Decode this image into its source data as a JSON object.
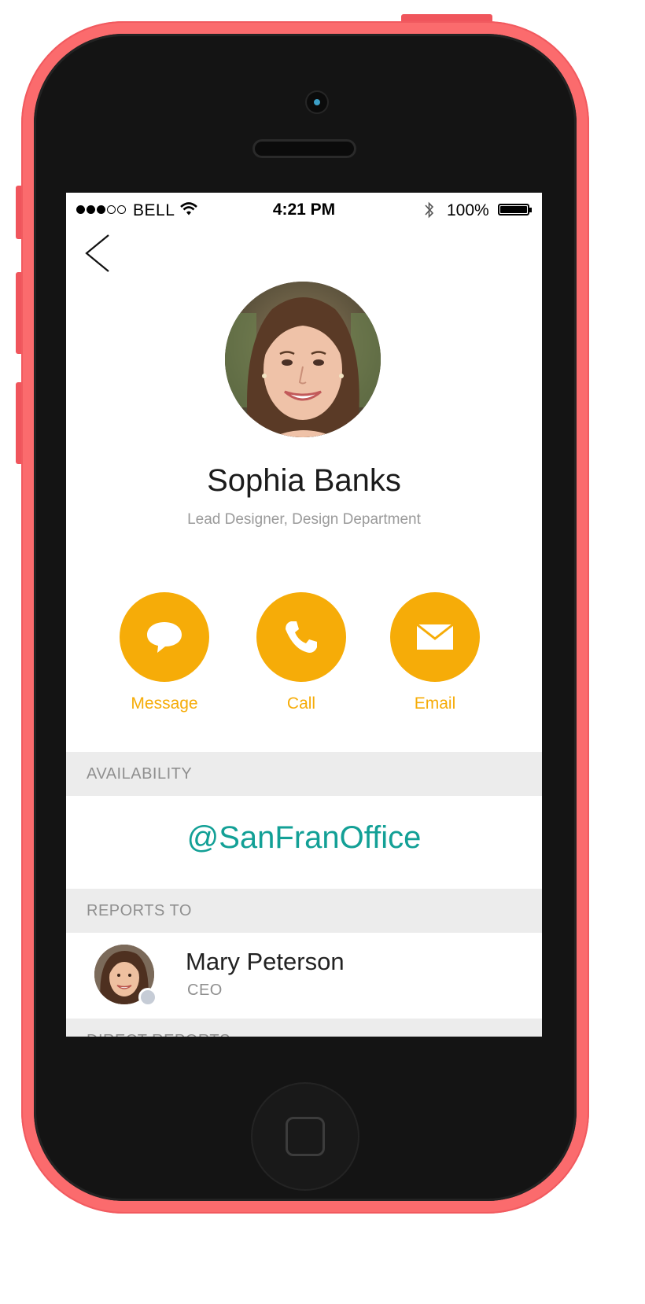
{
  "status_bar": {
    "carrier": "BELL",
    "time": "4:21 PM",
    "battery_percent": "100%",
    "signal_bars_filled": 3,
    "signal_bars_total": 5
  },
  "navigation": {
    "back_icon": "chevron-left-icon"
  },
  "profile": {
    "name": "Sophia Banks",
    "subtitle": "Lead Designer, Design Department"
  },
  "actions": [
    {
      "label": "Message",
      "icon": "speech-bubble-icon"
    },
    {
      "label": "Call",
      "icon": "phone-icon"
    },
    {
      "label": "Email",
      "icon": "envelope-icon"
    }
  ],
  "availability": {
    "header": "AVAILABILITY",
    "value": "@SanFranOffice"
  },
  "reports_to": {
    "header": "REPORTS TO",
    "name": "Mary Peterson",
    "title": "CEO"
  },
  "direct_reports": {
    "header": "DIRECT REPORTS"
  },
  "colors": {
    "accent": "#f6ac08",
    "availability_text": "#13a096",
    "section_header_bg": "#ececec",
    "phone_shell": "#fb6b6d",
    "bezel": "#141414"
  }
}
